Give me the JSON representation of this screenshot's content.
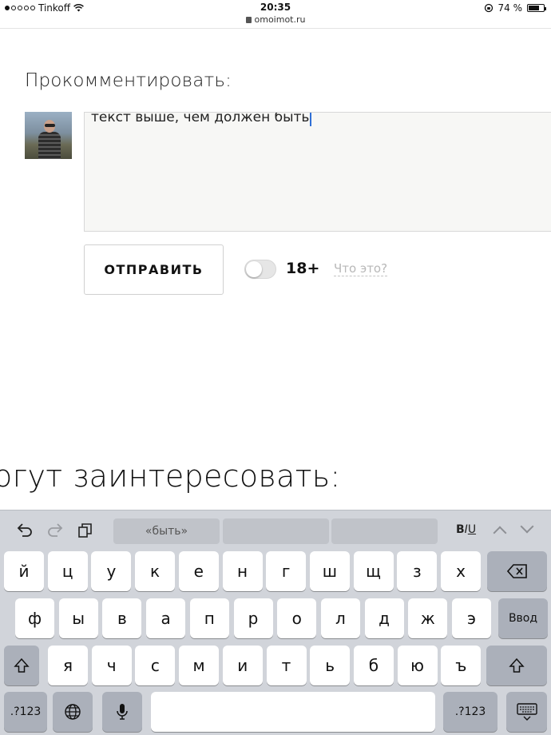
{
  "status_bar": {
    "carrier": "Tinkoff",
    "time": "20:35",
    "url": "omoimot.ru",
    "battery": "74 %",
    "battery_level": 0.74
  },
  "comment": {
    "heading": "Прокомментировать:",
    "text": "текст выше, чем должен быть",
    "send_label": "ОТПРАВИТЬ",
    "age_label": "18+",
    "age_toggle_on": false,
    "whats_this": "Что это?"
  },
  "related_heading": "огут заинтересовать:",
  "keyboard": {
    "suggestions": [
      "«быть»",
      "",
      ""
    ],
    "format": {
      "bold": "B",
      "italic": "I",
      "underline": "U"
    },
    "row1": [
      "й",
      "ц",
      "у",
      "к",
      "е",
      "н",
      "г",
      "ш",
      "щ",
      "з",
      "х"
    ],
    "row2": [
      "ф",
      "ы",
      "в",
      "а",
      "п",
      "р",
      "о",
      "л",
      "д",
      "ж",
      "э"
    ],
    "row3": [
      "я",
      "ч",
      "с",
      "м",
      "и",
      "т",
      "ь",
      "б",
      "ю",
      "ъ"
    ],
    "return_label": "Ввод",
    "numbers_label": ".?123",
    "icons": [
      "undo-icon",
      "redo-icon",
      "paste-icon",
      "delete-icon",
      "shift-icon",
      "globe-icon",
      "microphone-icon",
      "hide-keyboard-icon",
      "chevron-up-icon",
      "chevron-down-icon"
    ]
  }
}
